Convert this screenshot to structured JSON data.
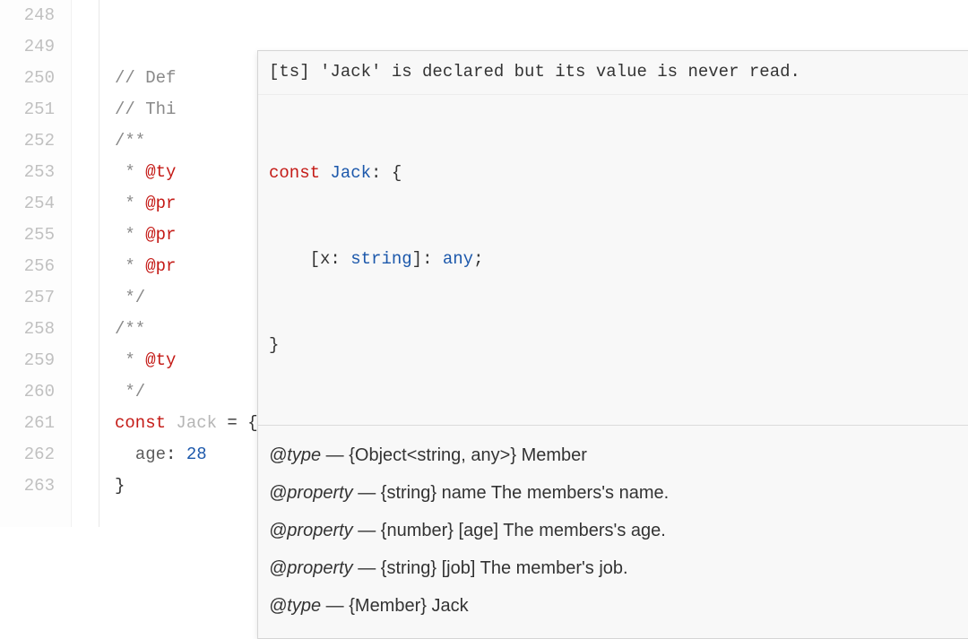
{
  "line_numbers": [
    "248",
    "249",
    "250",
    "251",
    "252",
    "253",
    "254",
    "255",
    "256",
    "257",
    "258",
    "259",
    "260",
    "261",
    "262",
    "263"
  ],
  "code": {
    "l250": "// Def",
    "l251": "// Thi",
    "l252": "/**",
    "l253_pre": " * ",
    "l253_tag": "@ty",
    "l254_pre": " * ",
    "l254_tag": "@pr",
    "l255_pre": " * ",
    "l255_tag": "@pr",
    "l256_pre": " * ",
    "l256_tag": "@pr",
    "l257": " */",
    "l258": "/**",
    "l259_pre": " * ",
    "l259_tag": "@ty",
    "l260": " */",
    "l261_const": "const ",
    "l261_name": "Jack",
    "l261_eq": " = {",
    "l262_indent": "  ",
    "l262_prop": "age",
    "l262_colon": ": ",
    "l262_val": "28",
    "l263": "}"
  },
  "hover": {
    "diagnostic": "[ts] 'Jack' is declared but its value is never read.",
    "sig": {
      "line1_kw": "const ",
      "line1_name": "Jack",
      "line1_punc1": ": {",
      "line2_indent": "    ",
      "line2_bracket_open": "[",
      "line2_key": "x",
      "line2_colon1": ": ",
      "line2_type1": "string",
      "line2_bracket_close": "]",
      "line2_colon2": ": ",
      "line2_type2": "any",
      "line2_semi": ";",
      "line3": "}"
    },
    "docs": [
      {
        "tag": "@type",
        "rest": " — {Object<string, any>} Member"
      },
      {
        "tag": "@property",
        "rest": " — {string} name The members's name."
      },
      {
        "tag": "@property",
        "rest": " — {number} [age] The members's age."
      },
      {
        "tag": "@property",
        "rest": " — {string} [job] The member's job."
      },
      {
        "tag": "@type",
        "rest": " — {Member} Jack"
      }
    ]
  }
}
